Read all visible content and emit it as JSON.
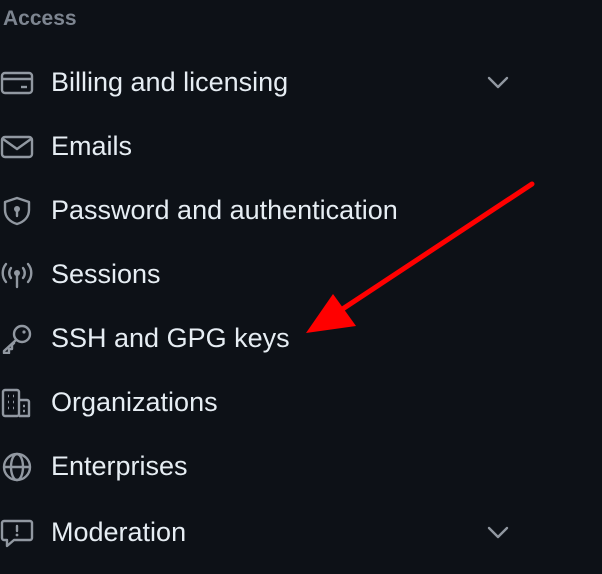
{
  "section": {
    "heading": "Access"
  },
  "items": [
    {
      "label": "Billing and licensing",
      "icon": "credit-card-icon",
      "expandable": true
    },
    {
      "label": "Emails",
      "icon": "mail-icon",
      "expandable": false
    },
    {
      "label": "Password and authentication",
      "icon": "shield-lock-icon",
      "expandable": false
    },
    {
      "label": "Sessions",
      "icon": "broadcast-icon",
      "expandable": false
    },
    {
      "label": "SSH and GPG keys",
      "icon": "key-icon",
      "expandable": false
    },
    {
      "label": "Organizations",
      "icon": "organization-icon",
      "expandable": false
    },
    {
      "label": "Enterprises",
      "icon": "globe-icon",
      "expandable": false
    },
    {
      "label": "Moderation",
      "icon": "report-icon",
      "expandable": true
    }
  ],
  "colors": {
    "background": "#0d1117",
    "text": "#e6edf3",
    "muted": "#7d8590",
    "icon": "#9198a1",
    "annotation": "#ff0000"
  }
}
